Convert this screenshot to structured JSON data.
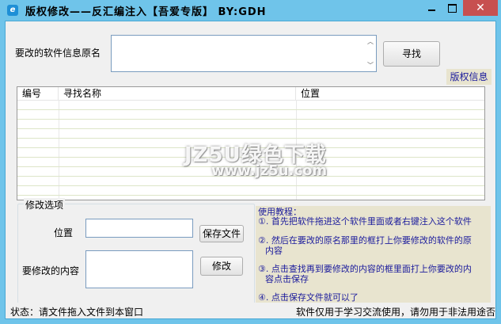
{
  "window": {
    "title": "版权修改——反汇编注入【吾爱专版】 BY:GDH",
    "icon_letter": "e",
    "minimize_icon": "minimize-icon",
    "maximize_icon": "maximize-icon",
    "close_glyph": "✕"
  },
  "search": {
    "label": "要改的软件信息原名",
    "input_value": "",
    "button_label": "寻找",
    "copyright_label": "版权信息"
  },
  "results": {
    "columns": [
      "编号",
      "寻找名称",
      "位置"
    ],
    "rows": []
  },
  "modify": {
    "group_title": "修改选项",
    "position_label": "位置",
    "position_value": "",
    "save_button": "保存文件",
    "content_label": "要修改的内容",
    "content_value": "",
    "modify_button": "修改"
  },
  "tutorial": {
    "title": "使用教程：",
    "lines": [
      "①. 首先把软件拖进这个软件里面或者右键注入这个软件",
      "②. 然后在要改的原名那里的框打上你要修改的软件的原",
      "内容",
      "③. 点击查找再到要修改的内容的框里面打上你要改的内",
      "容点击保存",
      "④. 点击保存文件就可以了"
    ]
  },
  "watermark": {
    "line1": "JZ5U绿色下载",
    "line2": "www.jz5u.com"
  },
  "status": {
    "left": "状态：请文件拖入文件到本窗口",
    "right": "软件仅用于学习交流使用，请勿用于非法用途否"
  },
  "colors": {
    "title_bar": "#6fc4ea",
    "close_button": "#c75050",
    "client_background": "#f0f0f0",
    "info_panel": "#e8e4cf",
    "info_text": "#1a1a9c"
  }
}
